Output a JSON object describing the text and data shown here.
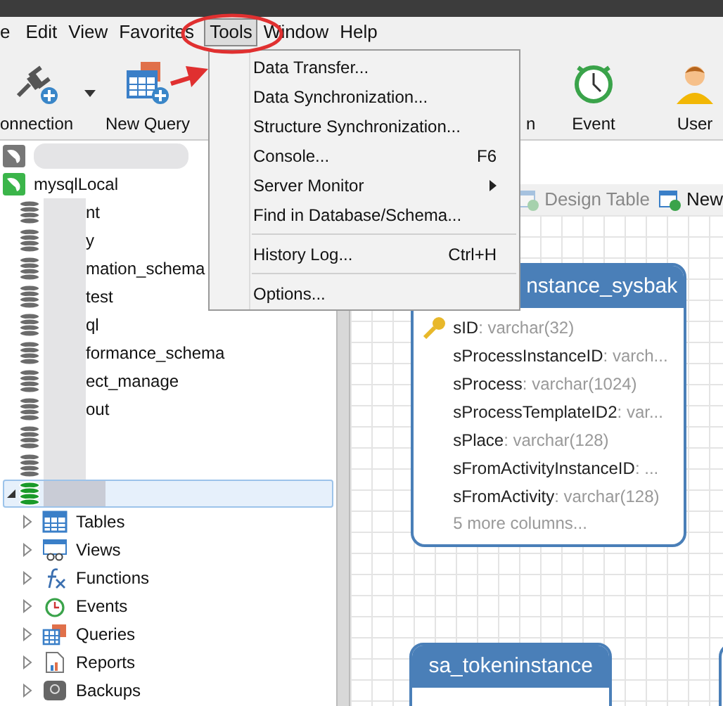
{
  "menu_bar": {
    "items": [
      {
        "label": "e",
        "selected": false
      },
      {
        "label": "Edit",
        "selected": false
      },
      {
        "label": "View",
        "selected": false
      },
      {
        "label": "Favorites",
        "selected": false
      },
      {
        "label": "Tools",
        "selected": true
      },
      {
        "label": "Window",
        "selected": false
      },
      {
        "label": "Help",
        "selected": false
      }
    ]
  },
  "toolbar": {
    "items": [
      {
        "kind": "connection",
        "label": "onnection"
      },
      {
        "kind": "query",
        "label": "New Query"
      },
      {
        "kind": "partial",
        "label": "n"
      },
      {
        "kind": "event",
        "label": "Event"
      },
      {
        "kind": "user",
        "label": "User"
      }
    ]
  },
  "tools_menu": {
    "items": [
      {
        "label": "Data Transfer...",
        "separator_before": false
      },
      {
        "label": "Data Synchronization...",
        "separator_before": false
      },
      {
        "label": "Structure Synchronization...",
        "separator_before": false
      },
      {
        "label": "Console...",
        "shortcut": "F6",
        "separator_before": false
      },
      {
        "label": "Server Monitor",
        "submenu": true,
        "separator_before": false
      },
      {
        "label": "Find in Database/Schema...",
        "separator_before": false
      },
      {
        "label": "History Log...",
        "shortcut": "Ctrl+H",
        "separator_before": true
      },
      {
        "label": "Options...",
        "separator_before": true
      }
    ]
  },
  "tree": [
    {
      "kind": "connection",
      "active": false
    },
    {
      "kind": "connection",
      "active": true,
      "label": "mysqlLocal",
      "children": [
        {
          "kind": "database",
          "label": "nt",
          "selected": false
        },
        {
          "kind": "database",
          "label": "y",
          "selected": false
        },
        {
          "kind": "database",
          "label": "mation_schema",
          "selected": false
        },
        {
          "kind": "database",
          "label": "test",
          "selected": false
        },
        {
          "kind": "database",
          "label": "ql",
          "selected": false
        },
        {
          "kind": "database",
          "label": "formance_schema",
          "selected": false
        },
        {
          "kind": "database",
          "label": "ect_manage",
          "selected": false
        },
        {
          "kind": "database",
          "label": "out",
          "selected": false
        },
        {
          "kind": "database",
          "selected": false
        },
        {
          "kind": "database",
          "selected": false
        },
        {
          "kind": "database",
          "selected": true,
          "children": [
            {
              "kind": "tables",
              "label": "Tables"
            },
            {
              "kind": "views",
              "label": "Views"
            },
            {
              "kind": "functions",
              "label": "Functions"
            },
            {
              "kind": "events",
              "label": "Events"
            },
            {
              "kind": "queries",
              "label": "Queries"
            },
            {
              "kind": "reports",
              "label": "Reports"
            },
            {
              "kind": "backups",
              "label": "Backups"
            }
          ]
        }
      ]
    }
  ],
  "canvas_toolbar": {
    "items": [
      {
        "label": "Design Table",
        "disabled": true
      },
      {
        "label": "New",
        "disabled": false
      }
    ]
  },
  "entities": [
    {
      "title": "nstance_sysbak",
      "columns": [
        {
          "name": "sID",
          "type": ": varchar(32)",
          "key": true
        },
        {
          "name": "sProcessInstanceID",
          "type": ": varch..."
        },
        {
          "name": "sProcess",
          "type": ": varchar(1024)"
        },
        {
          "name": "sProcessTemplateID2",
          "type": ": var..."
        },
        {
          "name": "sPlace",
          "type": ": varchar(128)"
        },
        {
          "name": "sFromActivityInstanceID",
          "type": ": ..."
        },
        {
          "name": "sFromActivity",
          "type": ": varchar(128)"
        }
      ],
      "more": "5 more columns..."
    },
    {
      "title": "sa_tokeninstance"
    }
  ]
}
